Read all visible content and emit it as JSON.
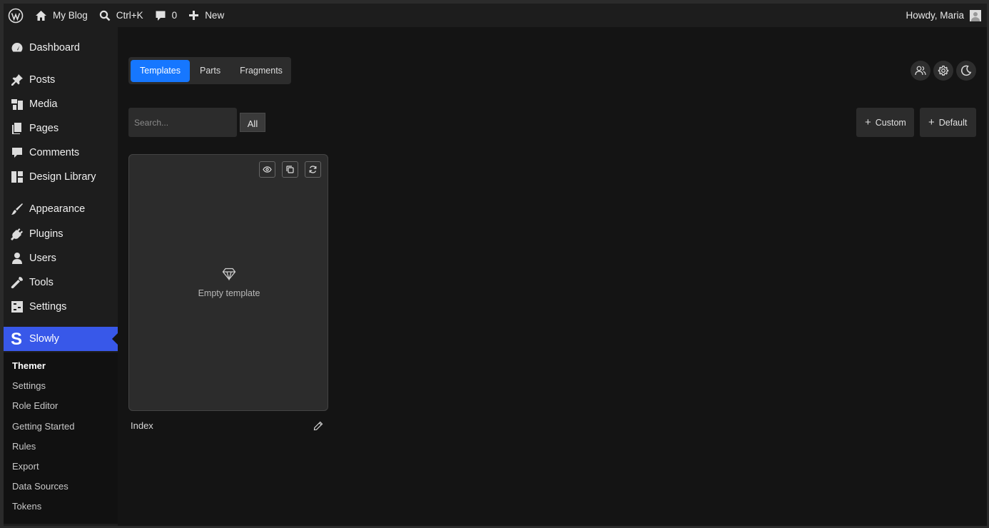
{
  "adminbar": {
    "site_name": "My Blog",
    "search_shortcut": "Ctrl+K",
    "comments_count": "0",
    "new_label": "New",
    "greeting": "Howdy, Maria"
  },
  "sidebar": {
    "items": [
      {
        "label": "Dashboard",
        "icon": "dashboard-icon"
      },
      {
        "label": "Posts",
        "icon": "pin-icon"
      },
      {
        "label": "Media",
        "icon": "media-icon"
      },
      {
        "label": "Pages",
        "icon": "pages-icon"
      },
      {
        "label": "Comments",
        "icon": "comment-icon"
      },
      {
        "label": "Design Library",
        "icon": "layout-icon"
      },
      {
        "label": "Appearance",
        "icon": "brush-icon"
      },
      {
        "label": "Plugins",
        "icon": "plug-icon"
      },
      {
        "label": "Users",
        "icon": "user-icon"
      },
      {
        "label": "Tools",
        "icon": "wrench-icon"
      },
      {
        "label": "Settings",
        "icon": "settings-icon"
      },
      {
        "label": "Slowly",
        "icon": "slowly-logo-icon"
      }
    ],
    "submenu": [
      "Themer",
      "Settings",
      "Role Editor",
      "Getting Started",
      "Rules",
      "Export",
      "Data Sources",
      "Tokens"
    ]
  },
  "main": {
    "tabs": [
      "Templates",
      "Parts",
      "Fragments"
    ],
    "search_placeholder": "Search...",
    "filter_label": "All",
    "add_custom_label": "Custom",
    "add_default_label": "Default",
    "card": {
      "empty_label": "Empty template",
      "title": "Index"
    }
  },
  "colors": {
    "accent_tab": "#1677ff",
    "active_menu": "#3858e9",
    "background": "#141414"
  }
}
